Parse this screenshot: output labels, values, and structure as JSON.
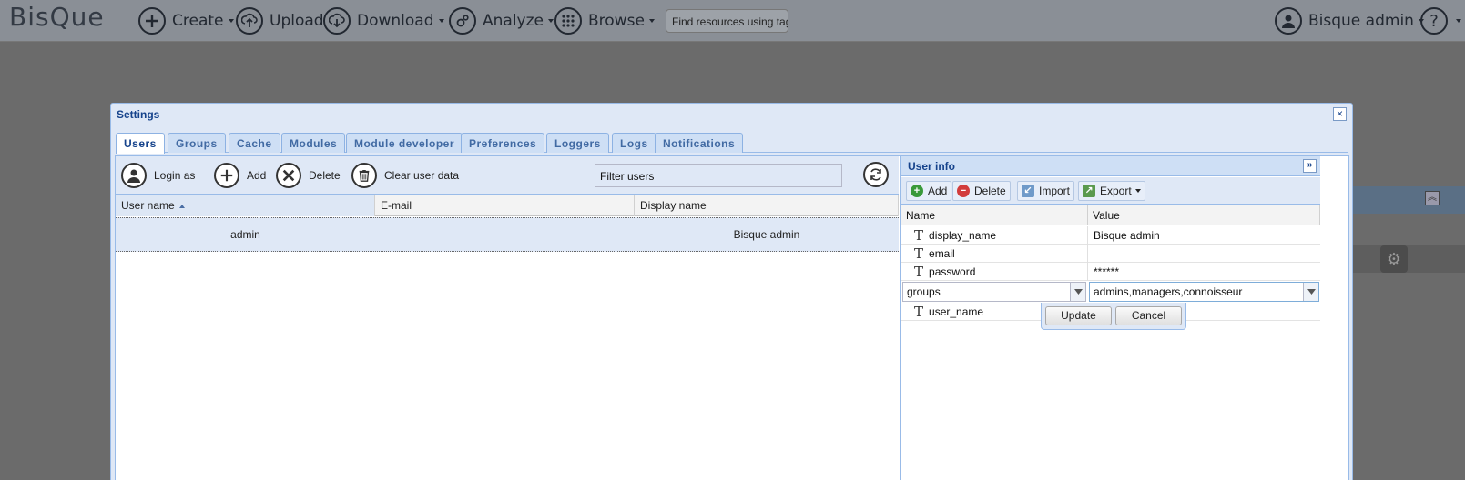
{
  "app": {
    "logo": "BisQue",
    "nav": [
      {
        "label": "Create",
        "icon": "plus-icon"
      },
      {
        "label": "Upload",
        "icon": "upload-icon"
      },
      {
        "label": "Download",
        "icon": "download-icon"
      },
      {
        "label": "Analyze",
        "icon": "gears-icon"
      },
      {
        "label": "Browse",
        "icon": "grid-icon"
      }
    ],
    "search_placeholder": "Find resources using tags",
    "user": "Bisque admin",
    "help": "?"
  },
  "dialog": {
    "title": "Settings",
    "close": "×",
    "tabs": [
      "Users",
      "Groups",
      "Cache",
      "Modules",
      "Module developer",
      "Preferences",
      "Loggers",
      "Logs",
      "Notifications"
    ],
    "active_tab": "Users"
  },
  "users": {
    "toolbar": {
      "login_as": "Login as",
      "add": "Add",
      "delete": "Delete",
      "clear": "Clear user data",
      "filter": "Filter users"
    },
    "columns": [
      "User name",
      "E-mail",
      "Display name"
    ],
    "rows": [
      {
        "user_name": "admin",
        "email": "",
        "display_name": "Bisque admin"
      }
    ]
  },
  "user_info": {
    "title": "User info",
    "expand": "»",
    "toolbar": {
      "add": "Add",
      "delete": "Delete",
      "import": "Import",
      "export": "Export"
    },
    "columns": [
      "Name",
      "Value"
    ],
    "props": [
      {
        "name": "display_name",
        "value": "Bisque admin"
      },
      {
        "name": "email",
        "value": ""
      },
      {
        "name": "password",
        "value": "******"
      }
    ],
    "editor": {
      "name": "groups",
      "value": "admins,managers,connoisseur"
    },
    "after": [
      {
        "name": "user_name",
        "value": ""
      }
    ],
    "update": "Update",
    "cancel": "Cancel"
  },
  "colors": {
    "accent": "#15428b",
    "panel": "#dfe8f6",
    "border": "#99bbe8"
  }
}
